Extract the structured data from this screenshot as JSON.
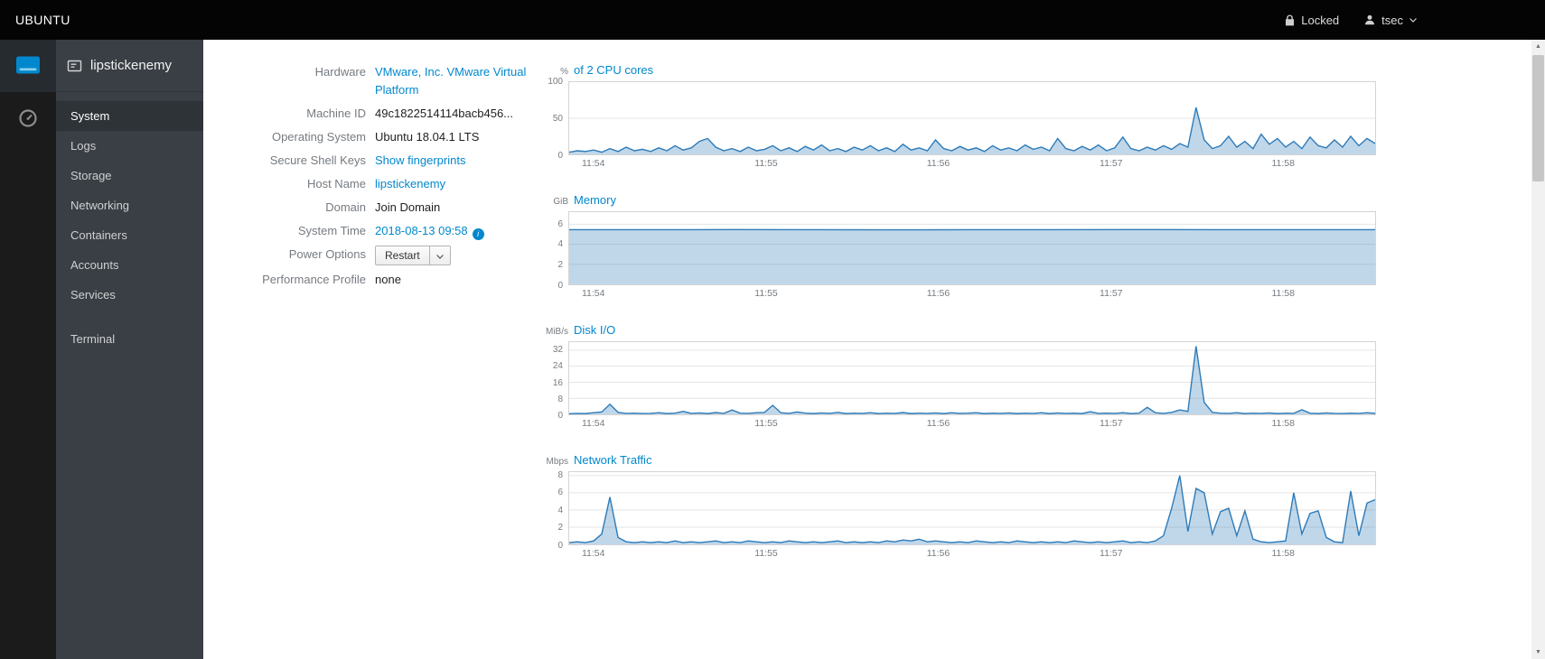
{
  "topbar": {
    "brand": "UBUNTU",
    "locked_label": "Locked",
    "user": "tsec"
  },
  "nav_strip": {
    "items": [
      {
        "icon": "server-machine-icon",
        "selected": true
      },
      {
        "icon": "dashboard-gauge-icon",
        "selected": false
      }
    ]
  },
  "sidebar": {
    "host": "lipstickenemy",
    "host_icon": "host-server-icon",
    "items": [
      {
        "label": "System",
        "selected": true
      },
      {
        "label": "Logs",
        "selected": false
      },
      {
        "label": "Storage",
        "selected": false
      },
      {
        "label": "Networking",
        "selected": false
      },
      {
        "label": "Containers",
        "selected": false
      },
      {
        "label": "Accounts",
        "selected": false
      },
      {
        "label": "Services",
        "selected": false
      }
    ],
    "tools": [
      {
        "label": "Terminal",
        "selected": false
      }
    ]
  },
  "system_info": {
    "rows": [
      {
        "label": "Hardware",
        "value": "VMware, Inc. VMware Virtual Platform",
        "type": "link"
      },
      {
        "label": "Machine ID",
        "value": "49c1822514114bacb456...",
        "type": "text"
      },
      {
        "label": "Operating System",
        "value": "Ubuntu 18.04.1 LTS",
        "type": "text"
      },
      {
        "label": "Secure Shell Keys",
        "value": "Show fingerprints",
        "type": "link"
      },
      {
        "label": "Host Name",
        "value": "lipstickenemy",
        "type": "link"
      },
      {
        "label": "Domain",
        "value": "Join Domain",
        "type": "text"
      },
      {
        "label": "System Time",
        "value": "2018-08-13 09:58",
        "type": "link-info",
        "info_icon": "info-circle-icon"
      },
      {
        "label": "Power Options",
        "value": "Restart",
        "type": "split-button",
        "caret_icon": "caret-down-icon"
      },
      {
        "label": "Performance Profile",
        "value": "none",
        "type": "text"
      }
    ]
  },
  "colors": {
    "accent": "#0088ce",
    "topbar_bg": "#040404",
    "strip_bg": "#1b1b1b",
    "sidebar_bg": "#393f45",
    "sidebar_selected_bg": "#2e3338",
    "chart_line": "#2e7bb8",
    "chart_fill": "rgba(46,123,184,0.30)",
    "grid": "#e5e5e5",
    "plot_border": "#d4d4d4",
    "label_gray": "#767b80"
  },
  "chart_data": [
    {
      "type": "area",
      "unit": "%",
      "title": "of 2 CPU cores",
      "ylim": [
        0,
        100
      ],
      "y_ticks": [
        0,
        50,
        100
      ],
      "gridlines": [
        50
      ],
      "x_ticks": [
        "11:54",
        "11:55",
        "11:56",
        "11:57",
        "11:58"
      ],
      "x_tick_fracs": [
        0.031,
        0.245,
        0.458,
        0.672,
        0.885
      ],
      "values": [
        3,
        5,
        4,
        6,
        3,
        8,
        4,
        10,
        5,
        7,
        4,
        9,
        5,
        12,
        6,
        9,
        18,
        22,
        10,
        5,
        8,
        4,
        10,
        5,
        7,
        12,
        5,
        9,
        4,
        11,
        6,
        13,
        5,
        8,
        4,
        10,
        6,
        12,
        5,
        9,
        4,
        14,
        6,
        9,
        5,
        20,
        8,
        5,
        11,
        6,
        9,
        4,
        12,
        6,
        9,
        5,
        13,
        7,
        10,
        5,
        22,
        8,
        5,
        11,
        6,
        13,
        5,
        9,
        24,
        8,
        5,
        10,
        6,
        12,
        7,
        15,
        10,
        65,
        20,
        8,
        12,
        25,
        10,
        18,
        8,
        28,
        14,
        22,
        10,
        18,
        8,
        24,
        12,
        9,
        20,
        10,
        25,
        12,
        22,
        15
      ]
    },
    {
      "type": "area",
      "unit": "GiB",
      "title": "Memory",
      "ylim": [
        0,
        7.2
      ],
      "y_ticks": [
        0,
        2,
        4,
        6
      ],
      "gridlines": [
        2,
        4,
        6
      ],
      "x_ticks": [
        "11:54",
        "11:55",
        "11:56",
        "11:57",
        "11:58"
      ],
      "x_tick_fracs": [
        0.031,
        0.245,
        0.458,
        0.672,
        0.885
      ],
      "values": [
        5.45,
        5.45,
        5.46,
        5.45,
        5.44,
        5.45,
        5.45,
        5.46,
        5.45,
        5.45,
        5.45
      ]
    },
    {
      "type": "area",
      "unit": "MiB/s",
      "title": "Disk I/O",
      "ylim": [
        0,
        36
      ],
      "y_ticks": [
        0,
        8,
        16,
        24,
        32
      ],
      "gridlines": [
        8,
        16,
        24,
        32
      ],
      "x_ticks": [
        "11:54",
        "11:55",
        "11:56",
        "11:57",
        "11:58"
      ],
      "x_tick_fracs": [
        0.031,
        0.245,
        0.458,
        0.672,
        0.885
      ],
      "values": [
        0.3,
        0.5,
        0.4,
        0.8,
        1.2,
        5,
        1,
        0.5,
        0.6,
        0.4,
        0.5,
        0.8,
        0.4,
        0.6,
        1.5,
        0.5,
        0.7,
        0.4,
        0.9,
        0.5,
        2.2,
        0.6,
        0.5,
        0.8,
        1,
        4.5,
        0.8,
        0.5,
        1.2,
        0.6,
        0.4,
        0.7,
        0.5,
        1,
        0.4,
        0.6,
        0.5,
        0.8,
        0.4,
        0.6,
        0.5,
        0.9,
        0.4,
        0.6,
        0.5,
        0.7,
        0.4,
        0.8,
        0.5,
        0.6,
        0.8,
        0.4,
        0.6,
        0.5,
        0.7,
        0.4,
        0.6,
        0.5,
        0.8,
        0.4,
        0.7,
        0.5,
        0.6,
        0.4,
        1.3,
        0.5,
        0.6,
        0.5,
        0.8,
        0.4,
        0.6,
        3.5,
        0.8,
        0.5,
        1,
        2.2,
        1.5,
        34,
        6,
        1,
        0.6,
        0.5,
        0.8,
        0.4,
        0.6,
        0.5,
        0.7,
        0.4,
        0.6,
        0.5,
        2.3,
        0.6,
        0.4,
        0.7,
        0.5,
        0.4,
        0.6,
        0.5,
        0.8,
        0.5
      ]
    },
    {
      "type": "area",
      "unit": "Mbps",
      "title": "Network Traffic",
      "ylim": [
        0,
        8.4
      ],
      "y_ticks": [
        0,
        2,
        4,
        6,
        8
      ],
      "gridlines": [
        2,
        4,
        6,
        8
      ],
      "x_ticks": [
        "11:54",
        "11:55",
        "11:56",
        "11:57",
        "11:58"
      ],
      "x_tick_fracs": [
        0.031,
        0.245,
        0.458,
        0.672,
        0.885
      ],
      "values": [
        0.2,
        0.3,
        0.2,
        0.4,
        1.2,
        5.5,
        0.8,
        0.3,
        0.2,
        0.3,
        0.2,
        0.3,
        0.2,
        0.4,
        0.2,
        0.3,
        0.2,
        0.3,
        0.4,
        0.2,
        0.3,
        0.2,
        0.4,
        0.3,
        0.2,
        0.3,
        0.2,
        0.4,
        0.3,
        0.2,
        0.3,
        0.2,
        0.3,
        0.4,
        0.2,
        0.3,
        0.2,
        0.3,
        0.2,
        0.4,
        0.3,
        0.5,
        0.4,
        0.6,
        0.3,
        0.4,
        0.3,
        0.2,
        0.3,
        0.2,
        0.4,
        0.3,
        0.2,
        0.3,
        0.2,
        0.4,
        0.3,
        0.2,
        0.3,
        0.2,
        0.3,
        0.2,
        0.4,
        0.3,
        0.2,
        0.3,
        0.2,
        0.3,
        0.4,
        0.2,
        0.3,
        0.2,
        0.4,
        1,
        4.2,
        8,
        1.5,
        6.5,
        6,
        1.2,
        3.8,
        4.2,
        1,
        3.9,
        0.6,
        0.3,
        0.2,
        0.3,
        0.4,
        6,
        1.2,
        3.6,
        3.9,
        0.8,
        0.3,
        0.2,
        6.2,
        1,
        4.8,
        5.2
      ]
    }
  ],
  "icons": {
    "topbar": [
      "lock-icon",
      "user-icon",
      "chevron-down-icon"
    ],
    "nav_strip": [
      "server-machine-icon",
      "dashboard-gauge-icon"
    ],
    "sidebar": [
      "host-server-icon"
    ],
    "system_info": [
      "info-circle-icon",
      "caret-down-icon"
    ],
    "scrollbar": [
      "scroll-up-arrow-icon",
      "scroll-down-arrow-icon"
    ]
  }
}
